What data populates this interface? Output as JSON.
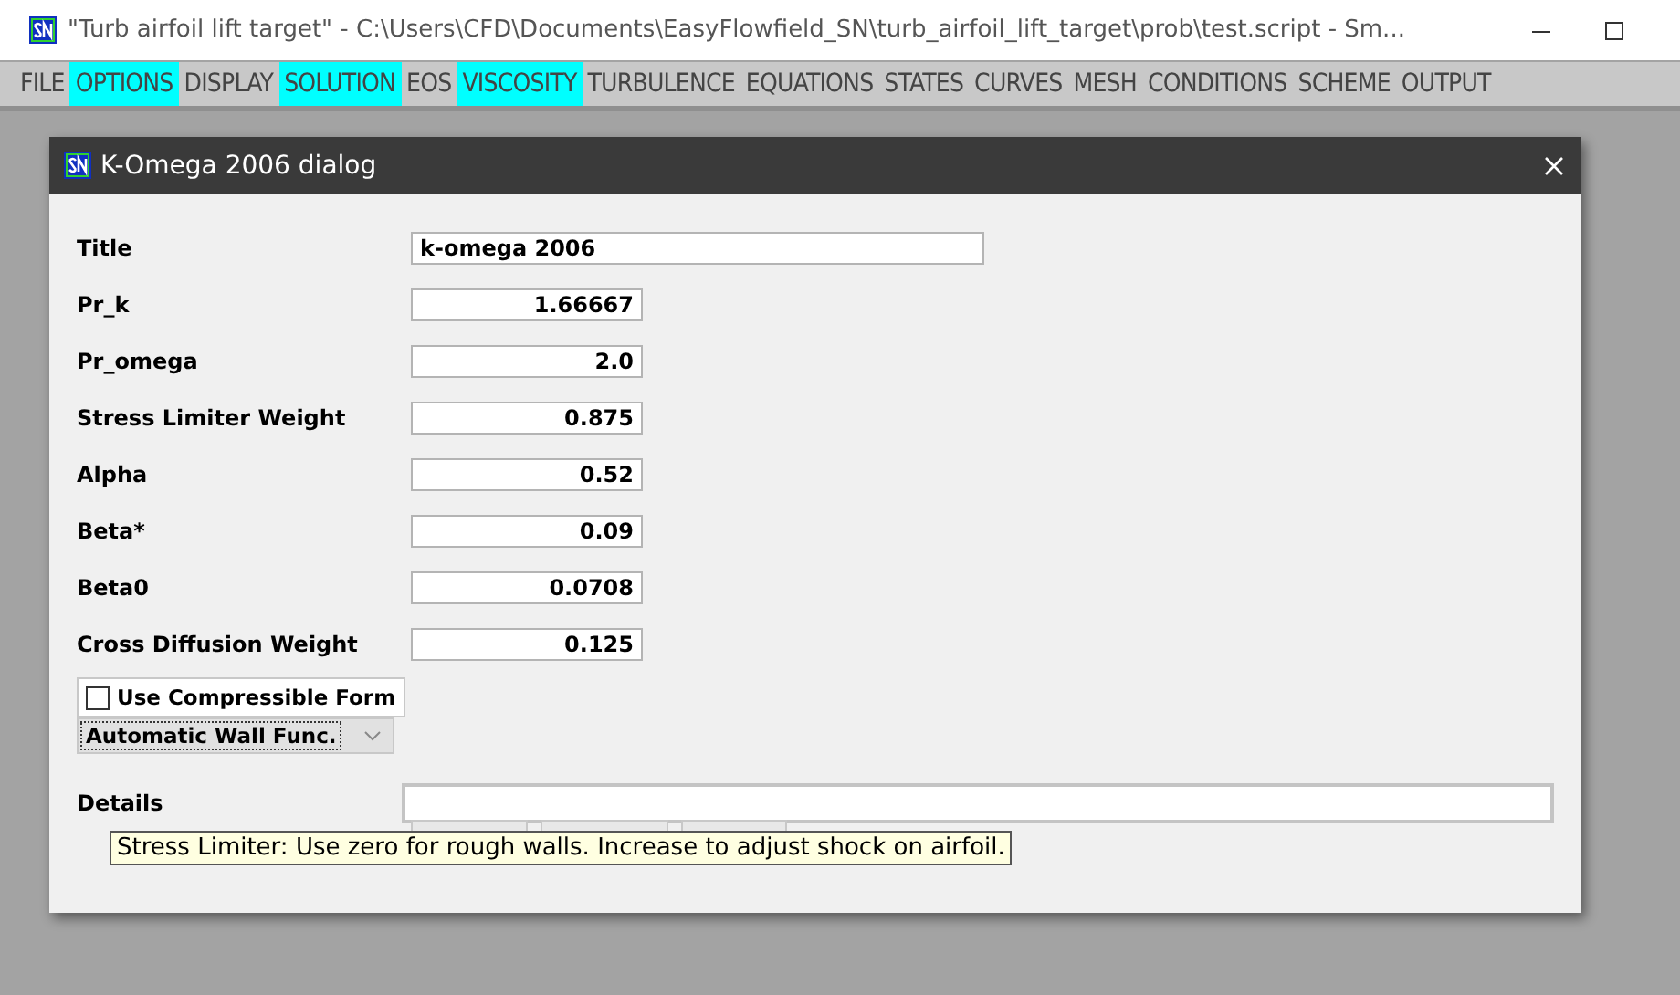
{
  "window": {
    "title": "\"Turb airfoil lift target\" - C:\\Users\\CFD\\Documents\\EasyFlowfield_SN\\turb_airfoil_lift_target\\prob\\test.script - Sm..."
  },
  "menu": [
    {
      "label": "FILE",
      "highlighted": false
    },
    {
      "label": "OPTIONS",
      "highlighted": true
    },
    {
      "label": "DISPLAY",
      "highlighted": false
    },
    {
      "label": "SOLUTION",
      "highlighted": true
    },
    {
      "label": "EOS",
      "highlighted": false
    },
    {
      "label": "VISCOSITY",
      "highlighted": true
    },
    {
      "label": "TURBULENCE",
      "highlighted": false
    },
    {
      "label": "EQUATIONS",
      "highlighted": false
    },
    {
      "label": "STATES",
      "highlighted": false
    },
    {
      "label": "CURVES",
      "highlighted": false
    },
    {
      "label": "MESH",
      "highlighted": false
    },
    {
      "label": "CONDITIONS",
      "highlighted": false
    },
    {
      "label": "SCHEME",
      "highlighted": false
    },
    {
      "label": "OUTPUT",
      "highlighted": false
    }
  ],
  "dialog": {
    "title": "K-Omega 2006 dialog",
    "fields": [
      {
        "label": "Title",
        "value": "k-omega 2006",
        "kind": "text"
      },
      {
        "label": "Pr_k",
        "value": "1.66667",
        "kind": "number"
      },
      {
        "label": "Pr_omega",
        "value": "2.0",
        "kind": "number"
      },
      {
        "label": "Stress Limiter Weight",
        "value": "0.875",
        "kind": "number"
      },
      {
        "label": "Alpha",
        "value": "0.52",
        "kind": "number"
      },
      {
        "label": "Beta*",
        "value": "0.09",
        "kind": "number"
      },
      {
        "label": "Beta0",
        "value": "0.0708",
        "kind": "number"
      },
      {
        "label": "Cross Diffusion Weight",
        "value": "0.125",
        "kind": "number"
      }
    ],
    "compressible": {
      "label": "Use Compressible Form",
      "checked": false
    },
    "wall_function": {
      "value": "Automatic Wall Func."
    },
    "details": {
      "label": "Details"
    },
    "tooltip": "Stress Limiter: Use zero for rough walls. Increase to adjust shock on airfoil."
  }
}
